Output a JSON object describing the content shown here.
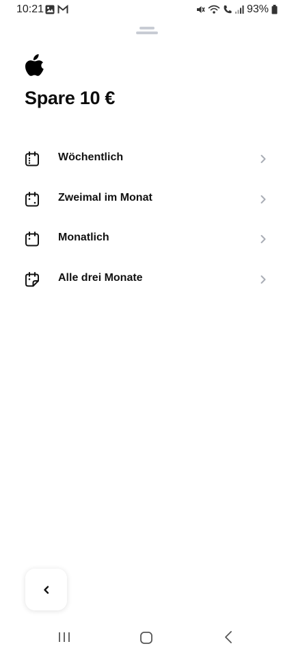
{
  "status_bar": {
    "time": "10:21",
    "battery": "93%",
    "left_icons": [
      "gallery-icon",
      "gmail-icon"
    ],
    "right_icons": [
      "mute-icon",
      "wifi-call-icon",
      "signal-icon",
      "battery-icon"
    ]
  },
  "header": {
    "logo": "apple-logo",
    "title": "Spare 10 €"
  },
  "options": [
    {
      "label": "Wöchentlich",
      "icon": "calendar-weekly-icon"
    },
    {
      "label": "Zweimal im Monat",
      "icon": "calendar-twice-monthly-icon"
    },
    {
      "label": "Monatlich",
      "icon": "calendar-monthly-icon"
    },
    {
      "label": "Alle drei Monate",
      "icon": "calendar-quarterly-icon"
    }
  ],
  "footer": {
    "back_icon": "chevron-left-icon"
  },
  "system_nav": [
    "recents-icon",
    "home-icon",
    "back-icon"
  ],
  "colors": {
    "text": "#111111",
    "chevron": "#a9adb5",
    "handle": "#c8ccd4",
    "background": "#ffffff"
  }
}
